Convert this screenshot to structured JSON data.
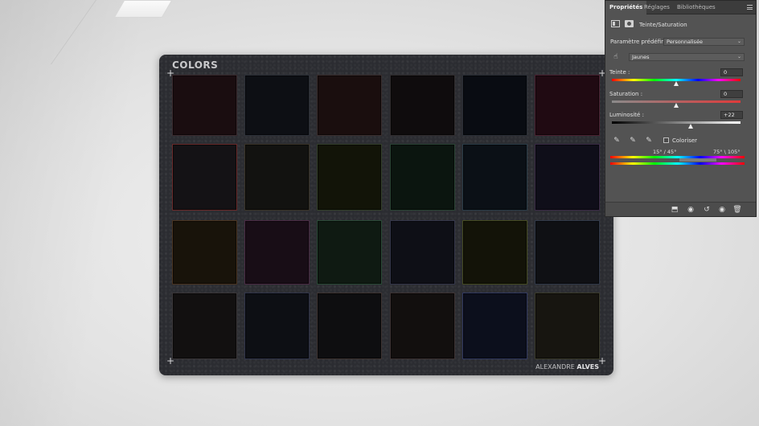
{
  "card": {
    "title": "COLORS",
    "brand_first": "ALEXANDRE",
    "brand_last": "ALVES",
    "plus": "+",
    "swatch_colors": [
      [
        "#1a0d10",
        "#0d0f14",
        "#1a0e0e",
        "#0f0c0d",
        "#090c12",
        "#200a12"
      ],
      [
        "#141215",
        "#121210",
        "#121408",
        "#0b150f",
        "#0b1016",
        "#0f0e19"
      ],
      [
        "#18130a",
        "#180d16",
        "#0f1a12",
        "#0e0f16",
        "#131308",
        "#0f1014"
      ],
      [
        "#121010",
        "#0d0f14",
        "#0e0e10",
        "#120f0e",
        "#0c0f1c",
        "#171510"
      ]
    ],
    "swatch_borders": [
      [
        "#3a2a2e",
        "#2c3038",
        "#3a2e2e",
        "#302c2e",
        "#2a2e36",
        "#4a2030"
      ],
      [
        "#6a2a2a",
        "#3a3428",
        "#34402a",
        "#2a4434",
        "#2a3c48",
        "#3a2a46"
      ],
      [
        "#4a3420",
        "#4a2a44",
        "#2a4a36",
        "#34364a",
        "#444a20",
        "#303848"
      ],
      [
        "#3a3638",
        "#30344a",
        "#3e3432",
        "#3c3232",
        "#303860",
        "#3a3a2a"
      ]
    ]
  },
  "panel": {
    "tabs": [
      "Propriétés",
      "Réglages",
      "Bibliothèques"
    ],
    "adjustment_title": "Teinte/Saturation",
    "preset_label": "Paramètre prédéfini :",
    "preset_value": "Personnalisée",
    "channel_value": "Jaunes",
    "hue_label": "Teinte :",
    "hue_value": "0",
    "hue_level": 0.5,
    "saturation_label": "Saturation :",
    "saturation_value": "0",
    "saturation_level": 0.5,
    "lightness_label": "Luminosité :",
    "lightness_value": "+22",
    "lightness_level": 0.61,
    "colorize_label": "Coloriser",
    "range_left": "15° / 45°",
    "range_right": "75° \\ 105°",
    "chevron": "⌄"
  }
}
